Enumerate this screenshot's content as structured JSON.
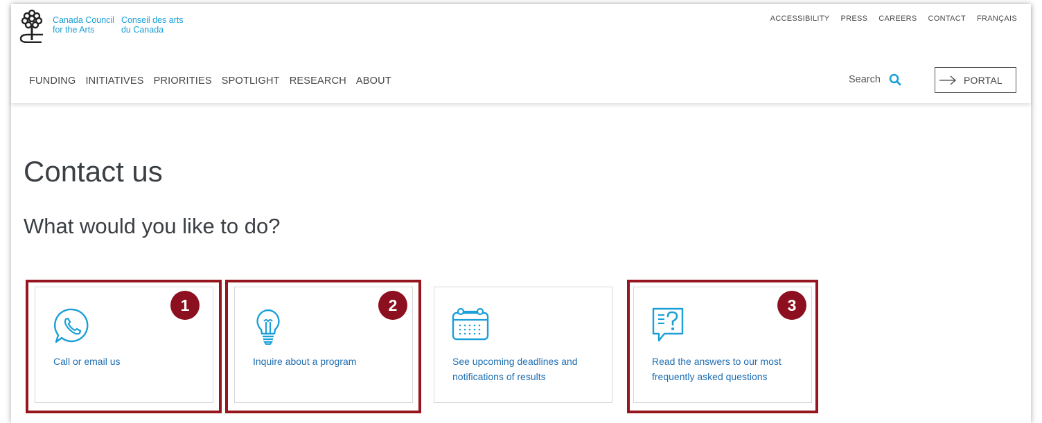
{
  "brand": {
    "name_en_line1": "Canada Council",
    "name_en_line2": "for the Arts",
    "name_fr_line1": "Conseil des arts",
    "name_fr_line2": "du Canada",
    "accent_color": "#1a9fd8"
  },
  "util_nav": [
    "ACCESSIBILITY",
    "PRESS",
    "CAREERS",
    "CONTACT",
    "FRANÇAIS"
  ],
  "main_nav": [
    "FUNDING",
    "INITIATIVES",
    "PRIORITIES",
    "SPOTLIGHT",
    "RESEARCH",
    "ABOUT"
  ],
  "search": {
    "label": "Search",
    "icon": "search-icon"
  },
  "portal": {
    "label": "PORTAL",
    "icon": "arrow-right-icon"
  },
  "page": {
    "title": "Contact us",
    "subtitle": "What would you like to do?"
  },
  "cards": [
    {
      "icon": "phone-chat-icon",
      "label": "Call or email us",
      "badge": "1"
    },
    {
      "icon": "lightbulb-icon",
      "label": "Inquire about a program",
      "badge": "2"
    },
    {
      "icon": "calendar-icon",
      "label": "See upcoming deadlines and notifications of results"
    },
    {
      "icon": "faq-question-icon",
      "label": "Read the answers to our most frequently asked questions",
      "badge": "3"
    }
  ],
  "highlight_color": "#96151f"
}
